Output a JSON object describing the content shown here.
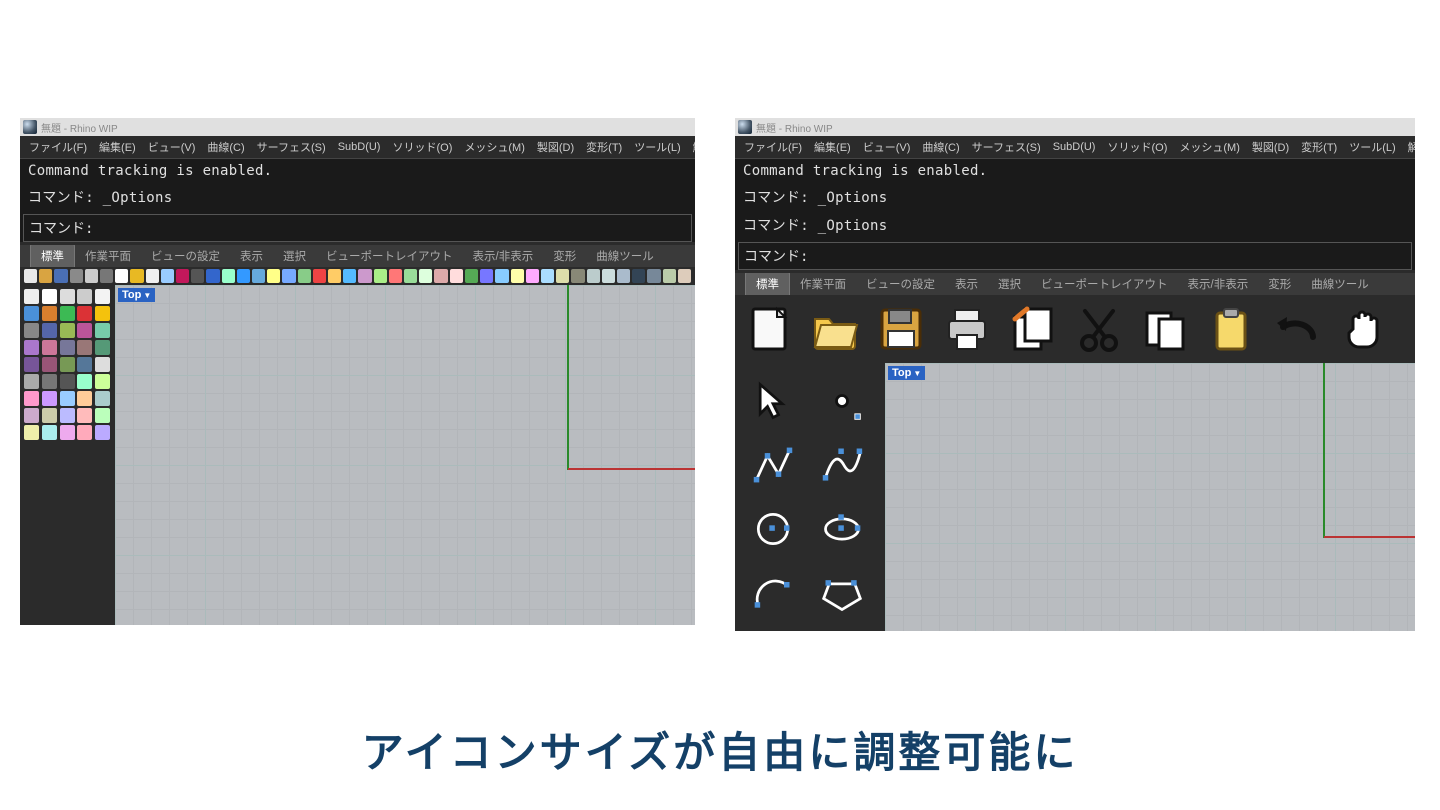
{
  "caption": "アイコンサイズが自由に調整可能に",
  "title": "無題 - Rhino WIP",
  "menus": [
    "ファイル(F)",
    "編集(E)",
    "ビュー(V)",
    "曲線(C)",
    "サーフェス(S)",
    "SubD(U)",
    "ソリッド(O)",
    "メッシュ(M)",
    "製図(D)",
    "変形(T)",
    "ツール(L)",
    "解析(A)"
  ],
  "cmd_left_lines": [
    "Command tracking is enabled.",
    "コマンド: _Options"
  ],
  "cmd_right_lines": [
    "Command tracking is enabled.",
    "コマンド: _Options",
    "コマンド: _Options"
  ],
  "cmd_prompt": "コマンド:",
  "tabs": [
    "標準",
    "作業平面",
    "ビューの設定",
    "表示",
    "選択",
    "ビューポートレイアウト",
    "表示/非表示",
    "変形",
    "曲線ツール"
  ],
  "viewport_label": "Top",
  "big_toolbar": [
    {
      "name": "new-file-icon",
      "title": "New"
    },
    {
      "name": "open-folder-icon",
      "title": "Open"
    },
    {
      "name": "save-floppy-icon",
      "title": "Save"
    },
    {
      "name": "print-icon",
      "title": "Print"
    },
    {
      "name": "clipboard-copy-icon",
      "title": "Copy"
    },
    {
      "name": "cut-scissors-icon",
      "title": "Cut"
    },
    {
      "name": "paste-docs-icon",
      "title": "Paste"
    },
    {
      "name": "clipboard-icon",
      "title": "Clipboard"
    },
    {
      "name": "undo-icon",
      "title": "Undo"
    },
    {
      "name": "pan-hand-icon",
      "title": "Pan"
    }
  ],
  "big_side": [
    {
      "name": "pointer-arrow-icon"
    },
    {
      "name": "point-icon"
    },
    {
      "name": "polyline-icon"
    },
    {
      "name": "interpcurve-icon"
    },
    {
      "name": "circle-icon"
    },
    {
      "name": "ellipse-icon"
    },
    {
      "name": "arc-icon"
    },
    {
      "name": "polygon-icon"
    }
  ],
  "small_toolbar_count": 44,
  "small_sidebar_count": 45
}
